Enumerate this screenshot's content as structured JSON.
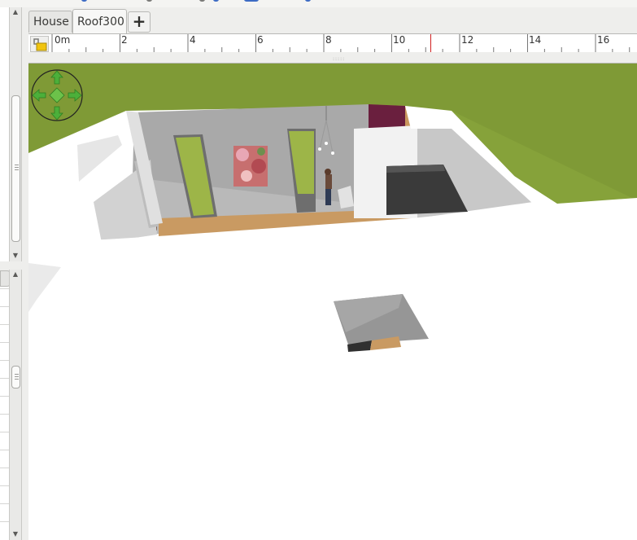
{
  "tabs": [
    {
      "label": "House",
      "active": false
    },
    {
      "label": "Roof300",
      "active": true
    }
  ],
  "add_tab_label": "+",
  "ruler": {
    "unit_label": "0m",
    "labels": [
      "0m",
      "2",
      "4",
      "6",
      "8",
      "10",
      "12",
      "14",
      "16"
    ],
    "marker_value": 11
  },
  "colors": {
    "grass": "#7f9a36",
    "floor": "#c99a62",
    "wall_top": "#ffffff",
    "wall_inner": "#a9a9a9",
    "ruler_marker": "#d02020",
    "nav_green": "#4caf3a"
  },
  "icons": [
    "lock-icon",
    "navigation-arrows-icon",
    "scroll-up-icon",
    "scroll-down-icon",
    "add-tab-icon"
  ]
}
